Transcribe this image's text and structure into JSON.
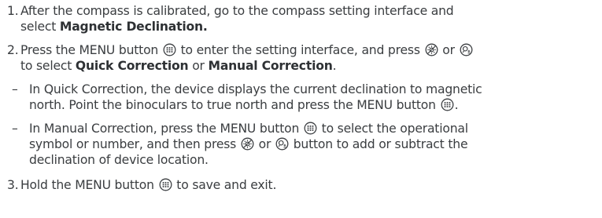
{
  "steps": [
    {
      "num": "1.",
      "line1": "After the compass is calibrated, go to the compass setting interface and",
      "line2_pre": "select ",
      "line2_bold": "Magnetic Declination."
    },
    {
      "num": "2.",
      "line1_pre": "Press the MENU button ",
      "line1_mid": " to enter the setting interface, and press ",
      "line1_or": " or ",
      "line2_pre": "to select ",
      "line2_bold1": "Quick Correction",
      "line2_or": " or ",
      "line2_bold2": "Manual Correction",
      "line2_end": ".",
      "subs": [
        {
          "dash": "–",
          "line1": "In Quick Correction, the device displays the current declination to magnetic",
          "line2_pre": "north. Point the binoculars to true north and press the MENU button ",
          "line2_end": "."
        },
        {
          "dash": "–",
          "line1_pre": "In Manual Correction, press the MENU button ",
          "line1_end": " to select the operational",
          "line2_pre": "symbol or number, and then press ",
          "line2_or": " or ",
          "line2_end": " button to add or subtract the",
          "line3": "declination of device location."
        }
      ]
    },
    {
      "num": "3.",
      "line1_pre": "Hold the MENU button ",
      "line1_end": " to save and exit."
    }
  ]
}
